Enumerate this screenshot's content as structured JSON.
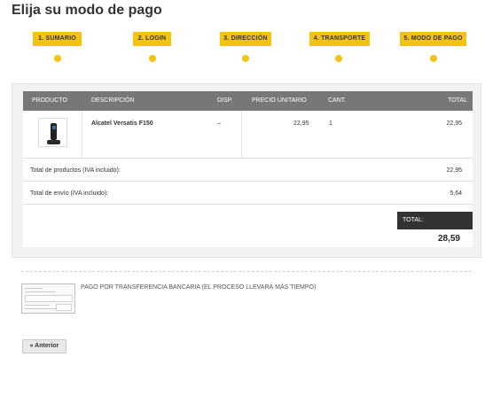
{
  "page": {
    "title": "Elija su modo de pago"
  },
  "steps": [
    {
      "label": "1. SUMARIO"
    },
    {
      "label": "2. LOGIN"
    },
    {
      "label": "3. DIRECCIÓN"
    },
    {
      "label": "4. TRANSPORTE"
    },
    {
      "label": "5. MODO DE PAGO"
    }
  ],
  "cart": {
    "headers": {
      "product": "PRODUCTO",
      "description": "DESCRIPCIÓN",
      "availability": "DISP.",
      "unit_price": "PRECIO UNITARIO",
      "quantity": "CANT.",
      "total": "TOTAL"
    },
    "items": [
      {
        "description": "Alcatel Versatis F150",
        "availability": "–",
        "unit_price": "22,95",
        "quantity": "1",
        "total": "22,95"
      }
    ],
    "products_total": {
      "label": "Total de productos (IVA incluido):",
      "value": "22,95"
    },
    "shipping_total": {
      "label": "Total de envío (IVA incluido):",
      "value": "5,64"
    },
    "grand_total": {
      "label": "TOTAL:",
      "value": "28,59"
    }
  },
  "payment": {
    "options": [
      {
        "label": "PAGO POR TRANSFERENCIA BANCARIA (EL PROCESO LLEVARÁ MÁS TIEMPO)",
        "icon": "bank-transfer-thumbnail"
      }
    ]
  },
  "nav": {
    "previous_label": "« Anterior"
  },
  "colors": {
    "accent": "#f4c211",
    "table_header": "#777777",
    "total_box": "#333333"
  }
}
